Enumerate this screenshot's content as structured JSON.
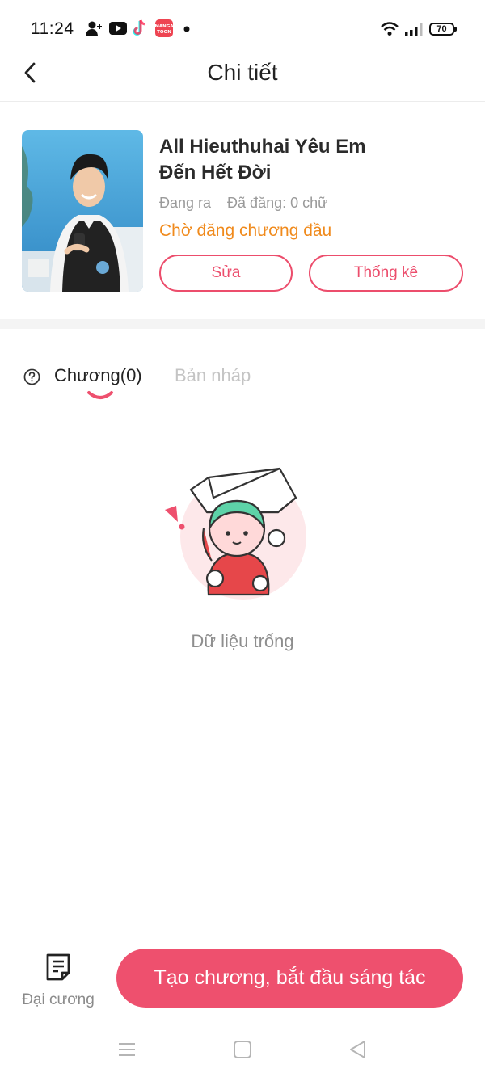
{
  "status_bar": {
    "time": "11:24",
    "battery": "70",
    "icons": [
      "add-friend-icon",
      "youtube-icon",
      "tiktok-icon",
      "mangatoon-icon",
      "notification-dot-icon",
      "wifi-icon",
      "signal-icon",
      "battery-icon"
    ],
    "mangatoon_label": "MANGA TOON"
  },
  "header": {
    "title": "Chi tiết",
    "back_icon": "chevron-left-icon"
  },
  "book": {
    "title": "All Hieuthuhai Yêu Em Đến Hết Đời",
    "status": "Đang ra",
    "word_count": "Đã đăng: 0 chữ",
    "publish_status": "Chờ đăng chương đầu",
    "edit_label": "Sửa",
    "stats_label": "Thống kê"
  },
  "tabs": [
    {
      "label": "Chương(0)",
      "active": true
    },
    {
      "label": "Bản nháp",
      "active": false
    }
  ],
  "empty_state": {
    "text": "Dữ liệu trống"
  },
  "bottom": {
    "outline_label": "Đại cương",
    "create_label": "Tạo chương, bắt đầu sáng tác"
  },
  "colors": {
    "accent": "#ee506e",
    "warning": "#f08a1c",
    "muted": "#9a9a9a"
  }
}
